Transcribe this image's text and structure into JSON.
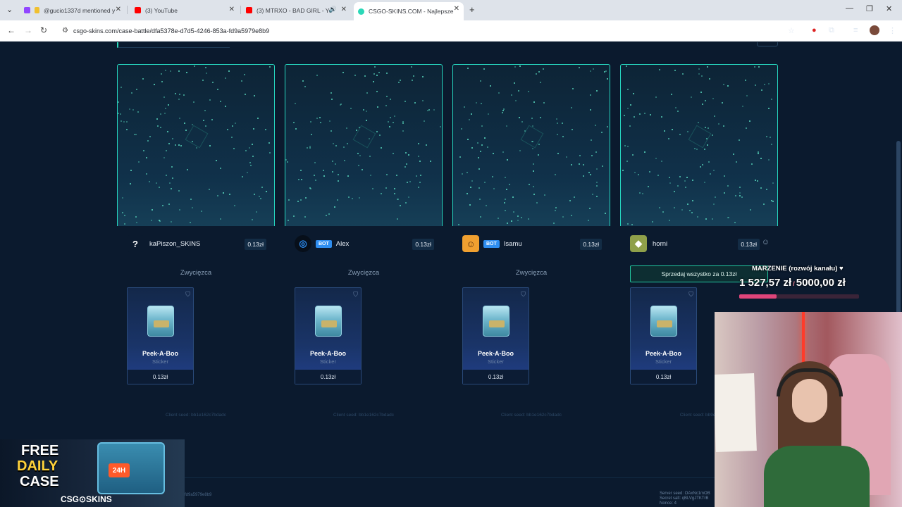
{
  "browser": {
    "tabs": [
      {
        "label": "@gucio1337d mentioned y",
        "color": "#9146ff"
      },
      {
        "label": "(3) YouTube",
        "color": "#ff0000"
      },
      {
        "label": "(3) MTRXO - BAD GIRL - Yo",
        "color": "#ff0000"
      },
      {
        "label": "CSGO-SKINS.COM - Najlepsze",
        "color": "#2bd8b8"
      }
    ],
    "url": "csgo-skins.com/case-battle/dfa5378e-d7d5-4246-853a-fd9a5979e8b9"
  },
  "battle": {
    "players": [
      {
        "name": "kaPiszon_SKINS",
        "bot": false,
        "bot_label": "",
        "price": "0.13zł",
        "avatar_icon": "question-mark-icon"
      },
      {
        "name": "Alex",
        "bot": true,
        "bot_label": "BOT",
        "price": "0.13zł",
        "avatar_icon": "target-icon"
      },
      {
        "name": "Isamu",
        "bot": true,
        "bot_label": "BOT",
        "price": "0.13zł",
        "avatar_icon": "person-icon"
      },
      {
        "name": "horni",
        "bot": false,
        "bot_label": "",
        "price": "0.13zł",
        "avatar_icon": "character-icon"
      }
    ],
    "winner_label": "Zwycięzca",
    "sell_all_label": "Sprzedaj wszystko za 0.13zł",
    "items": [
      {
        "name": "Peek-A-Boo",
        "type": "Sticker",
        "price": "0.13zł"
      },
      {
        "name": "Peek-A-Boo",
        "type": "Sticker",
        "price": "0.13zł"
      },
      {
        "name": "Peek-A-Boo",
        "type": "Sticker",
        "price": "0.13zł"
      },
      {
        "name": "Peek-A-Boo",
        "type": "Sticker",
        "price": "0.13zł"
      }
    ],
    "client_seeds": [
      "Client seed: bb1e162c7bdadc",
      "Client seed: bb1e162c7bdadc",
      "Client seed: bb1e162c7bdadc",
      "Client seed: bb9e0"
    ],
    "battle_id": "fd9a5979e8b9",
    "server_seed": "Server seed: OAxNc1mOB",
    "secret_salt": "Secret salt: qBLVgJTKTrB",
    "nonce": "Nonce: 4"
  },
  "overlay": {
    "goal_title": "MARZENIE (rozwój kanału) ♥",
    "current": "1 527,57 zł",
    "separator": "/",
    "target": "5000,00 zł",
    "progress": 0.31,
    "accent": "#e0457a"
  },
  "promo": {
    "line1": "FREE",
    "line2": "DAILY",
    "line3": "CASE",
    "badge": "24H",
    "brand": "CSG⊙SKINS"
  }
}
